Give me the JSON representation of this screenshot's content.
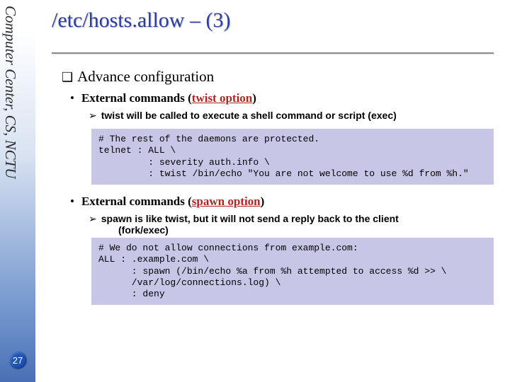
{
  "sidebar": {
    "label": "Computer Center, CS, NCTU",
    "page_number": "27"
  },
  "title": "/etc/hosts.allow – (3)",
  "section_heading": "Advance configuration",
  "bullets": {
    "b1_prefix": "External commands (",
    "b1_opt": "twist option",
    "b1_suffix": ")",
    "b1_sub": "twist will be called to execute a shell command or script (exec)",
    "b2_prefix": "External commands (",
    "b2_opt": "spawn option",
    "b2_suffix": ")",
    "b2_sub": "spawn is like twist, but it will not send a reply back to the client",
    "b2_sub2": "(fork/exec)"
  },
  "code1": "# The rest of the daemons are protected.\ntelnet : ALL \\\n         : severity auth.info \\\n         : twist /bin/echo \"You are not welcome to use %d from %h.\"",
  "code2": "# We do not allow connections from example.com:\nALL : .example.com \\\n      : spawn (/bin/echo %a from %h attempted to access %d >> \\\n      /var/log/connections.log) \\\n      : deny"
}
